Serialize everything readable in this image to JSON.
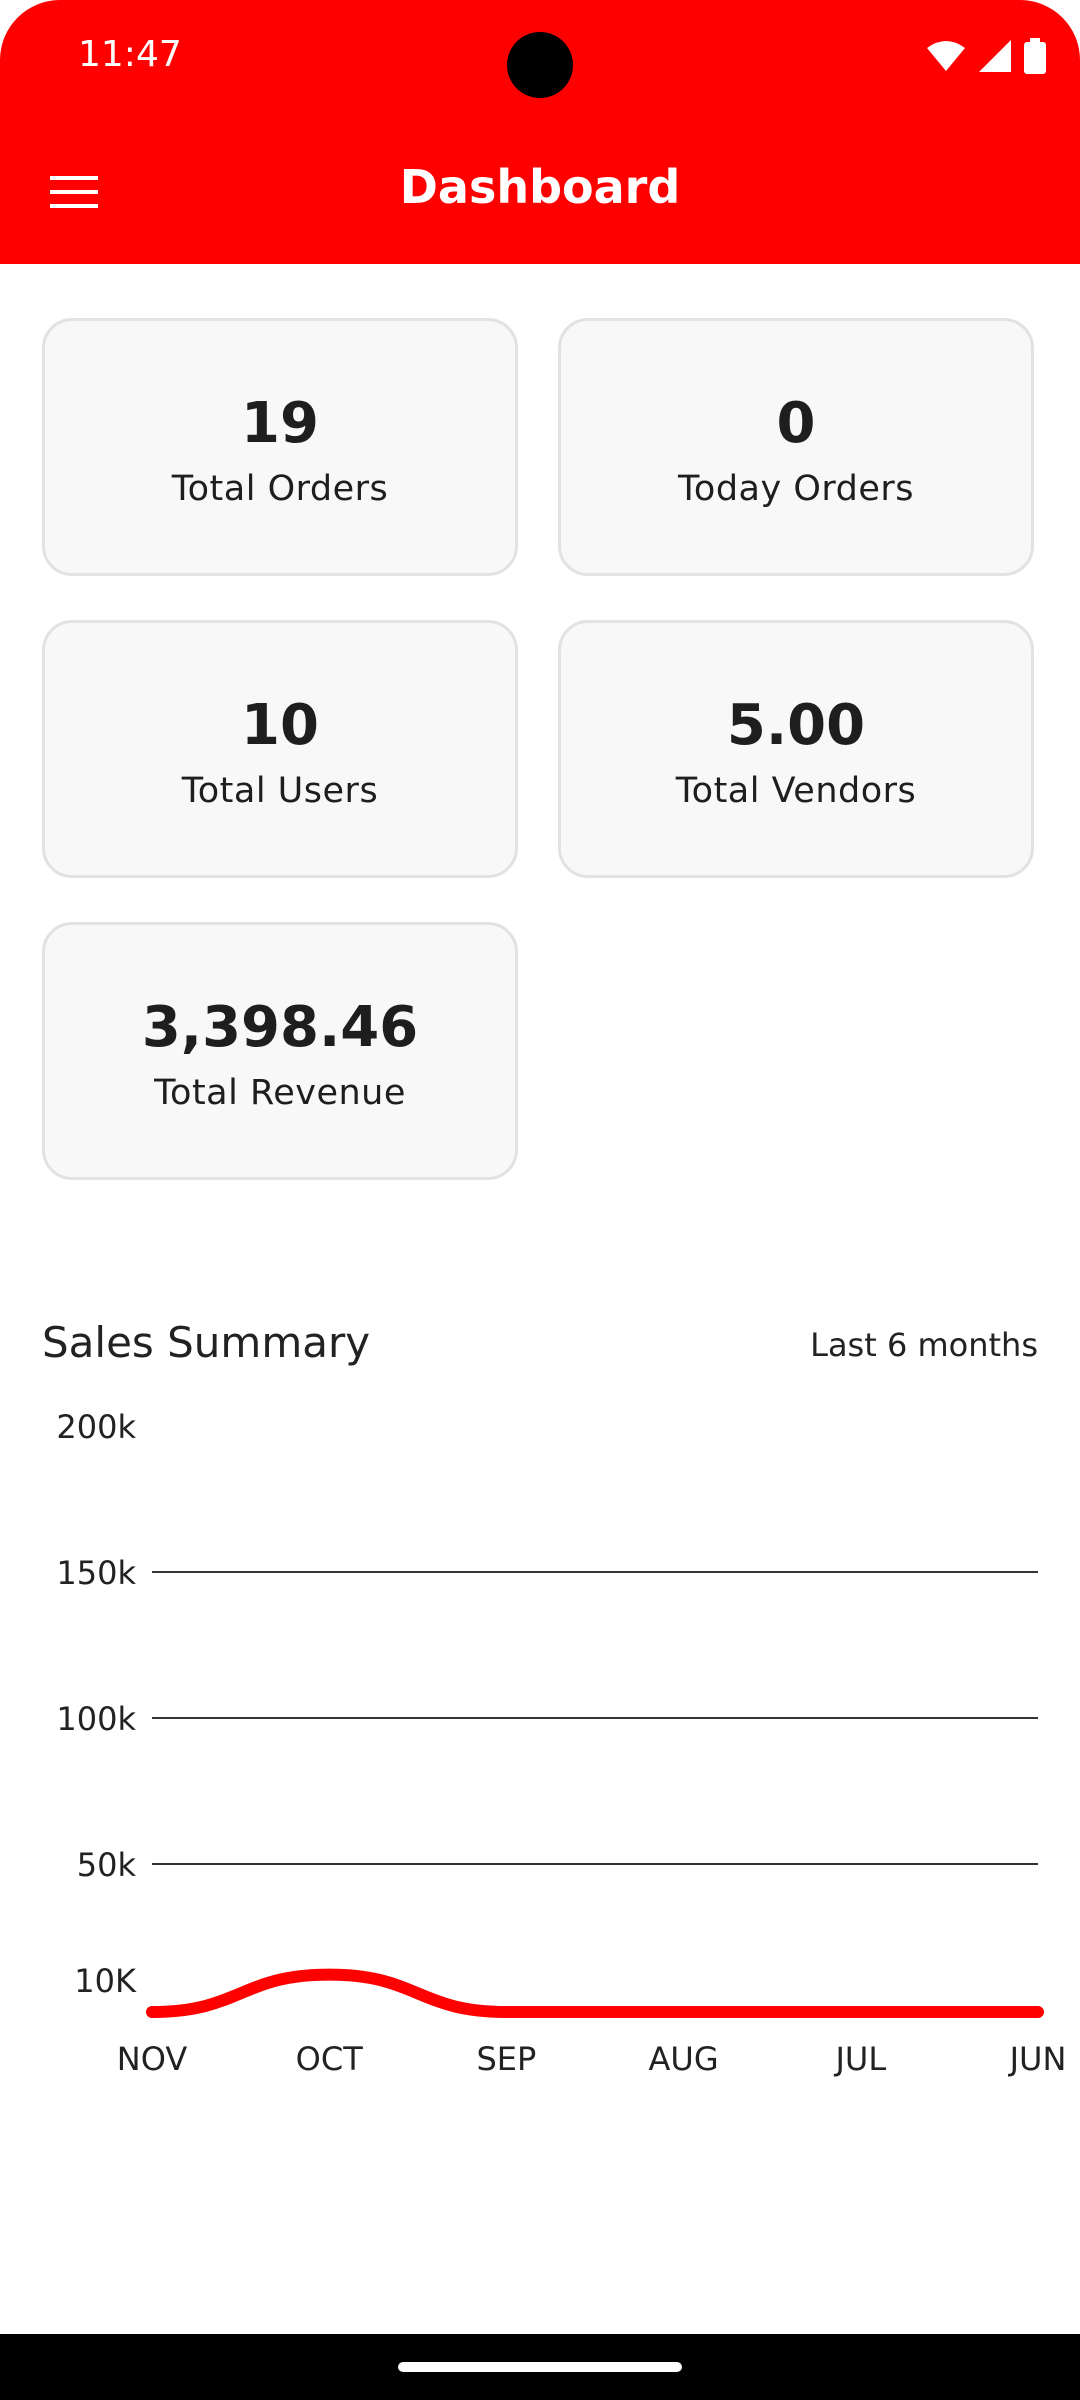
{
  "status_bar": {
    "time": "11:47"
  },
  "app_bar": {
    "title": "Dashboard",
    "menu_icon": "hamburger-menu-icon"
  },
  "stats": [
    {
      "value": "19",
      "label": "Total Orders"
    },
    {
      "value": "0",
      "label": "Today Orders"
    },
    {
      "value": "10",
      "label": "Total Users"
    },
    {
      "value": "5.00",
      "label": "Total Vendors"
    },
    {
      "value": "3,398.46",
      "label": "Total Revenue"
    }
  ],
  "sales": {
    "title": "Sales Summary",
    "range": "Last 6 months"
  },
  "colors": {
    "primary": "#ff0000",
    "card_bg": "#f8f8f8"
  },
  "chart_data": {
    "type": "line",
    "categories": [
      "NOV",
      "OCT",
      "SEP",
      "AUG",
      "JUL",
      "JUN"
    ],
    "y_tick_labels": [
      "200k",
      "150k",
      "100k",
      "50k",
      "10K"
    ],
    "series": [
      {
        "values": [
          0,
          3398.46,
          0,
          0,
          0,
          0
        ],
        "color": "#ff0000"
      }
    ],
    "ylim": [
      0,
      200000
    ],
    "grid": true
  }
}
